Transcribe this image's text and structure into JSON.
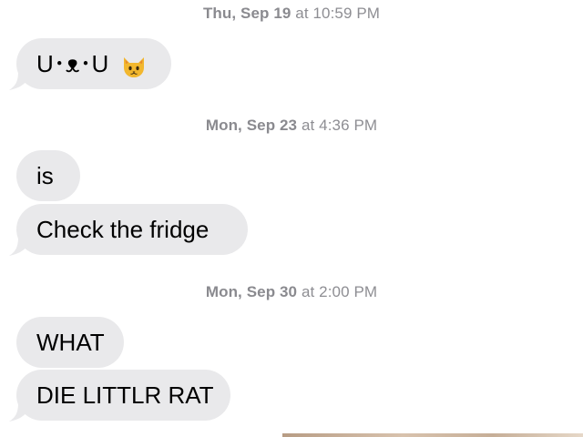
{
  "thread": {
    "timestamps": [
      {
        "day": "Thu, Sep 19",
        "time": "at 10:59 PM"
      },
      {
        "day": "Mon, Sep 23",
        "time": "at 4:36 PM"
      },
      {
        "day": "Mon, Sep 30",
        "time": "at 2:00 PM"
      }
    ],
    "messages": [
      {
        "text": "U･ᴥ･U",
        "emoji": "cat-face-emoji"
      },
      {
        "text": "is"
      },
      {
        "text": "Check the fridge"
      },
      {
        "text": "WHAT"
      },
      {
        "text": "DIE LITTLR RAT"
      }
    ]
  },
  "colors": {
    "bubble_incoming": "#e9e9eb",
    "timestamp_text": "#8e8e93",
    "background": "#ffffff"
  }
}
